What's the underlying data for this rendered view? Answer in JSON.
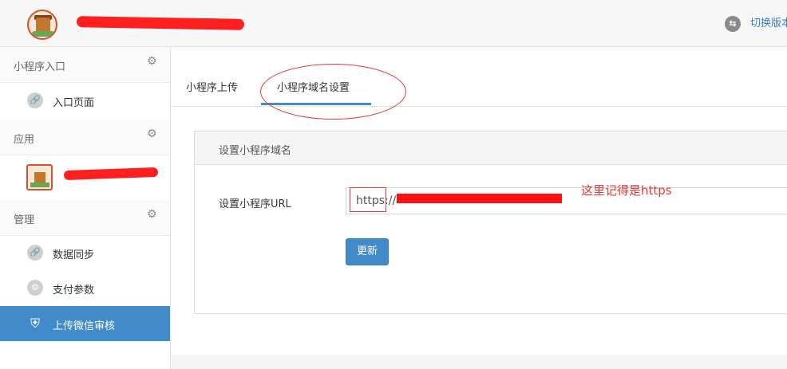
{
  "header": {
    "switch_icon": "swap-icon",
    "switch_label": "切换版本"
  },
  "sidebar": {
    "sections": [
      {
        "label": "小程序入口",
        "items": [
          {
            "label": "入口页面",
            "icon": "link-icon"
          }
        ]
      },
      {
        "label": "应用",
        "items": []
      },
      {
        "label": "管理",
        "items": [
          {
            "label": "数据同步",
            "icon": "link-icon"
          },
          {
            "label": "支付参数",
            "icon": "gear-icon"
          },
          {
            "label": "上传微信审核",
            "icon": "shield-icon",
            "active": true
          }
        ]
      }
    ]
  },
  "tabs": [
    {
      "label": "小程序上传",
      "active": false
    },
    {
      "label": "小程序域名设置",
      "active": true
    }
  ],
  "panel": {
    "title": "设置小程序域名",
    "url_label": "设置小程序URL",
    "url_value": "https://",
    "update_button": "更新"
  },
  "annotation": "这里记得是https",
  "colors": {
    "accent": "#428bca",
    "annotation_red": "#e53935",
    "link_blue": "#3a7cc4"
  }
}
